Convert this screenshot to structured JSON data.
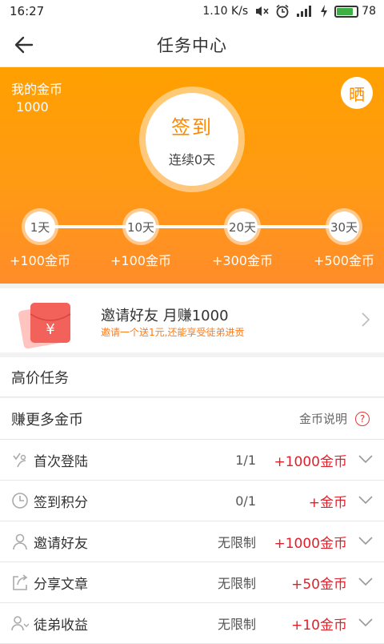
{
  "status": {
    "time": "16:27",
    "speed": "1.10 K/s",
    "battery": "78",
    "battery_level": 0.78
  },
  "header": {
    "title": "任务中心"
  },
  "hero": {
    "coins_label": "我的金币",
    "coins_value": "1000",
    "share_label": "晒",
    "sign_title": "签到",
    "sign_streak": "连续0天",
    "milestones": [
      {
        "day": "1天",
        "reward": "+100金币"
      },
      {
        "day": "10天",
        "reward": "+100金币"
      },
      {
        "day": "20天",
        "reward": "+300金币"
      },
      {
        "day": "30天",
        "reward": "+500金币"
      }
    ]
  },
  "invite": {
    "envelope_symbol": "¥",
    "title": "邀请好友 月赚1000",
    "subtitle": "邀请一个送1元,还能享受徒弟进贡"
  },
  "high_tasks": {
    "title": "高价任务"
  },
  "earn": {
    "title": "赚更多金币",
    "info_label": "金币说明",
    "info_icon": "?"
  },
  "tasks": [
    {
      "icon": "login-icon",
      "name": "首次登陆",
      "progress": "1/1",
      "reward": "+1000金币"
    },
    {
      "icon": "clock-icon",
      "name": "签到积分",
      "progress": "0/1",
      "reward": "+金币"
    },
    {
      "icon": "user-icon",
      "name": "邀请好友",
      "progress": "无限制",
      "reward": "+1000金币"
    },
    {
      "icon": "share-icon",
      "name": "分享文章",
      "progress": "无限制",
      "reward": "+50金币"
    },
    {
      "icon": "apprentice-icon",
      "name": "徒弟收益",
      "progress": "无限制",
      "reward": "+10金币"
    }
  ],
  "colors": {
    "accent": "#ff9a14",
    "reward": "#e0202a",
    "invite_sub": "#ff7a1a"
  }
}
